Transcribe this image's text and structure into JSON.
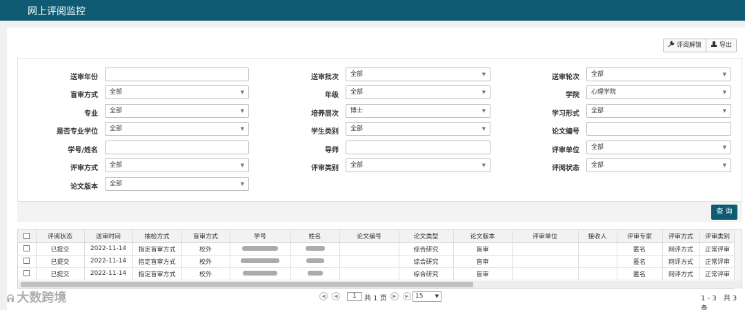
{
  "header": {
    "title": "网上评阅监控"
  },
  "toolbar": {
    "unlock_label": "评阅解锁",
    "export_label": "导出"
  },
  "filters": {
    "send_year": {
      "label": "送审年份",
      "value": ""
    },
    "send_batch": {
      "label": "送审批次",
      "value": "全部"
    },
    "send_round": {
      "label": "送审轮次",
      "value": "全部"
    },
    "blind_mode": {
      "label": "盲审方式",
      "value": "全部"
    },
    "grade": {
      "label": "年级",
      "value": "全部"
    },
    "college": {
      "label": "学院",
      "value": "心理学院"
    },
    "major": {
      "label": "专业",
      "value": "全部"
    },
    "level": {
      "label": "培养层次",
      "value": "博士"
    },
    "study_form": {
      "label": "学习形式",
      "value": "全部"
    },
    "prof_degree": {
      "label": "是否专业学位",
      "value": "全部"
    },
    "student_type": {
      "label": "学生类别",
      "value": "全部"
    },
    "thesis_no": {
      "label": "论文编号",
      "value": ""
    },
    "student_id_name": {
      "label": "学号/姓名",
      "value": ""
    },
    "advisor": {
      "label": "导师",
      "value": ""
    },
    "review_unit": {
      "label": "评审单位",
      "value": "全部"
    },
    "review_mode": {
      "label": "评审方式",
      "value": "全部"
    },
    "review_type": {
      "label": "评审类别",
      "value": "全部"
    },
    "review_status": {
      "label": "评阅状态",
      "value": "全部"
    },
    "thesis_version": {
      "label": "论文版本",
      "value": "全部"
    }
  },
  "search_label": "查 询",
  "table": {
    "columns": [
      "评阅状态",
      "送审时间",
      "抽检方式",
      "盲审方式",
      "学号",
      "姓名",
      "论文编号",
      "论文类型",
      "论文版本",
      "评审单位",
      "接收人",
      "评审专家",
      "评审方式",
      "评审类别"
    ],
    "rows": [
      {
        "status": "已提交",
        "date": "2022-11-14",
        "sampling": "指定盲审方式",
        "blind": "校外",
        "student_id": "",
        "name": "",
        "thesis_no": "",
        "type": "综合研究",
        "version": "盲审",
        "unit": "",
        "receiver": "",
        "expert": "匿名",
        "mode": "网评方式",
        "category": "正常评审"
      },
      {
        "status": "已提交",
        "date": "2022-11-14",
        "sampling": "指定盲审方式",
        "blind": "校外",
        "student_id": "",
        "name": "",
        "thesis_no": "",
        "type": "综合研究",
        "version": "盲审",
        "unit": "",
        "receiver": "",
        "expert": "匿名",
        "mode": "网评方式",
        "category": "正常评审"
      },
      {
        "status": "已提交",
        "date": "2022-11-14",
        "sampling": "指定盲审方式",
        "blind": "校外",
        "student_id": "",
        "name": "",
        "thesis_no": "",
        "type": "综合研究",
        "version": "盲审",
        "unit": "",
        "receiver": "",
        "expert": "匿名",
        "mode": "网评方式",
        "category": "正常评审"
      }
    ]
  },
  "pager": {
    "current_page": "1",
    "total_pages_text": "共 1 页",
    "page_size": "15",
    "summary": "1 - 3　共 3 条"
  },
  "watermark": "大数跨境",
  "colors": {
    "primary": "#0f5b73"
  }
}
